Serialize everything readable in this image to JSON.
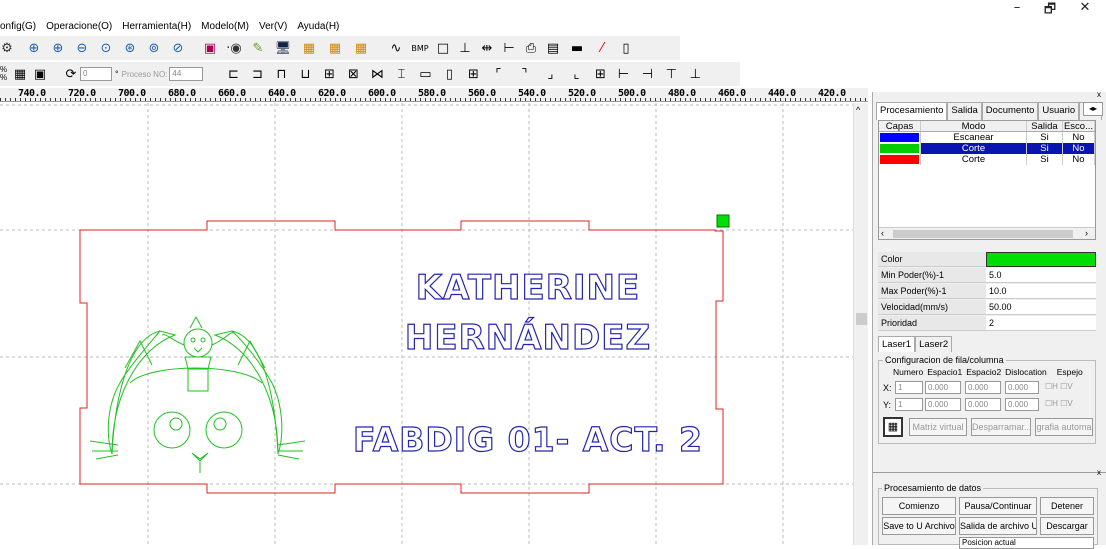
{
  "window": {
    "min": "–",
    "max": "🗗",
    "close": "✕"
  },
  "menu": [
    "onfig(G)",
    "Operacione(O)",
    "Herramienta(H)",
    "Modelo(M)",
    "Ver(V)",
    "Ayuda(H)"
  ],
  "toolbar2": {
    "angle_value": "0",
    "degree": "°",
    "proceso_label": "Proceso NO:",
    "proceso_value": "44",
    "pct_top": "%",
    "pct_bot": "%"
  },
  "ruler_ticks": [
    "740.0",
    "720.0",
    "700.0",
    "680.0",
    "660.0",
    "640.0",
    "620.0",
    "600.0",
    "580.0",
    "560.0",
    "540.0",
    "520.0",
    "500.0",
    "480.0",
    "460.0",
    "440.0",
    "420.0"
  ],
  "design": {
    "line1": "KATHERINE",
    "line2": "HERNÁNDEZ",
    "line3": "FABDIG 01- ACT. 2"
  },
  "panel": {
    "tabs": [
      "Procesamiento",
      "Salida",
      "Documento",
      "Usuario",
      "Pru"
    ],
    "layer_headers": [
      "Capas",
      "Modo",
      "Salida",
      "Esco..."
    ],
    "layers": [
      {
        "color": "#0000ff",
        "mode": "Escanear",
        "output": "Si",
        "esc": "No"
      },
      {
        "color": "#00cc00",
        "mode": "Corte",
        "output": "Si",
        "esc": "No"
      },
      {
        "color": "#ff0000",
        "mode": "Corte",
        "output": "Si",
        "esc": "No"
      }
    ],
    "props": [
      {
        "k": "Color",
        "v": ""
      },
      {
        "k": "Min Poder(%)-1",
        "v": "5.0"
      },
      {
        "k": "Max Poder(%)-1",
        "v": "10.0"
      },
      {
        "k": "Velocidad(mm/s)",
        "v": "50.00"
      },
      {
        "k": "Prioridad",
        "v": "2"
      }
    ],
    "color_value": "#00dd00",
    "laser_tabs": [
      "Laser1",
      "Laser2"
    ],
    "config_title": "Configuracion de fila/columna",
    "config_headers": [
      "Numero",
      "Espacio1",
      "Espacio2",
      "Dislocation",
      "Espejo"
    ],
    "x_label": "X:",
    "y_label": "Y:",
    "x_vals": [
      "1",
      "0.000",
      "0.000",
      "0.000"
    ],
    "y_vals": [
      "1",
      "0.000",
      "0.000",
      "0.000"
    ],
    "mirror_h": "H",
    "mirror_v": "V",
    "matrix_buttons": [
      "Matriz virtual",
      "Desparramar...",
      "grafia automa"
    ],
    "proc_title": "Procesamiento de datos",
    "proc_buttons": [
      "Comienzo",
      "Pausa/Continuar",
      "Detener",
      "Save to U Archivo",
      "Salida de archivo U",
      "Descargar"
    ],
    "pos_label": "Posicion actual"
  }
}
